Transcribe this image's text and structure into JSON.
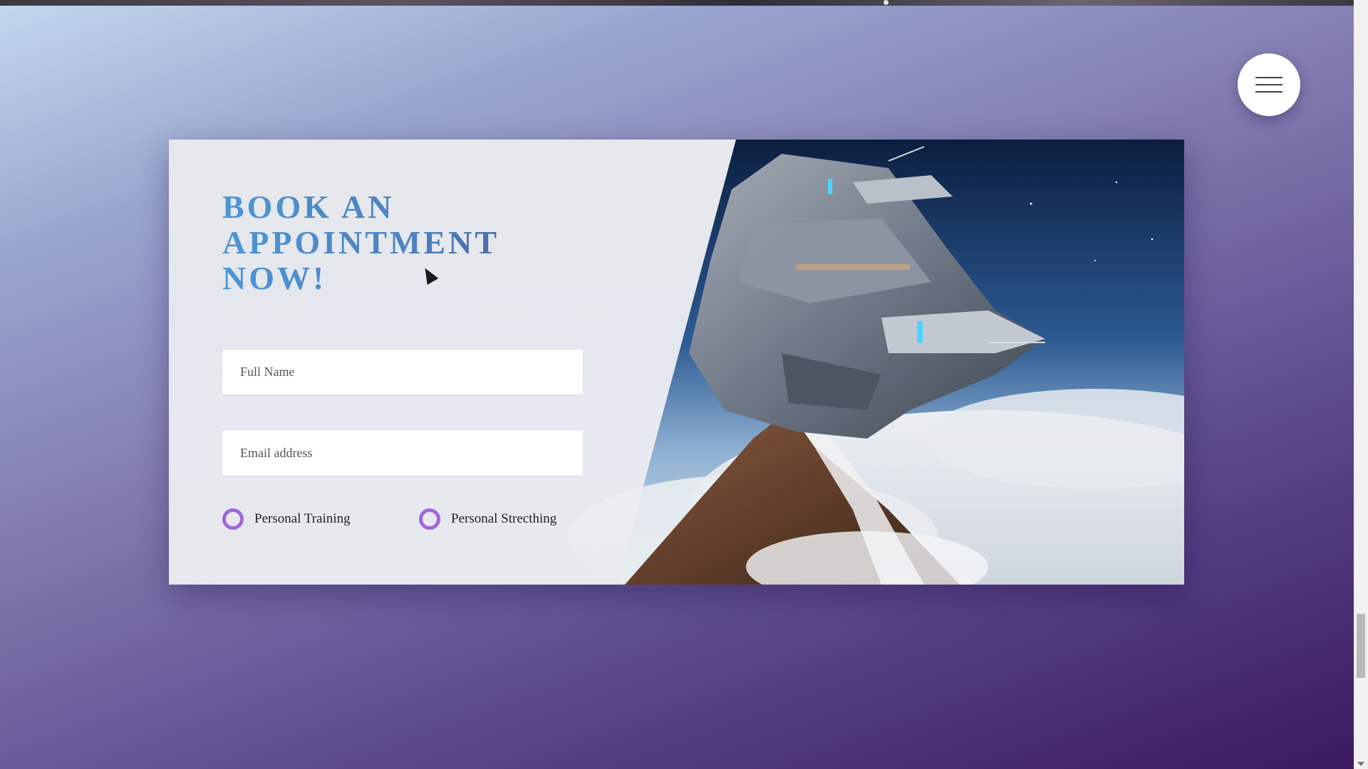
{
  "menu": {
    "icon": "hamburger-icon"
  },
  "appointment": {
    "title_line1": "BOOK AN",
    "title_line2": "APPOINTMENT NOW!",
    "full_name_placeholder": "Full Name",
    "email_placeholder": "Email address",
    "options": [
      {
        "label": "Personal Training"
      },
      {
        "label": "Personal Strecthing"
      }
    ],
    "accent_color": "#a266e0"
  },
  "image": {
    "description_icon": "spaceship-over-mountain-image"
  }
}
